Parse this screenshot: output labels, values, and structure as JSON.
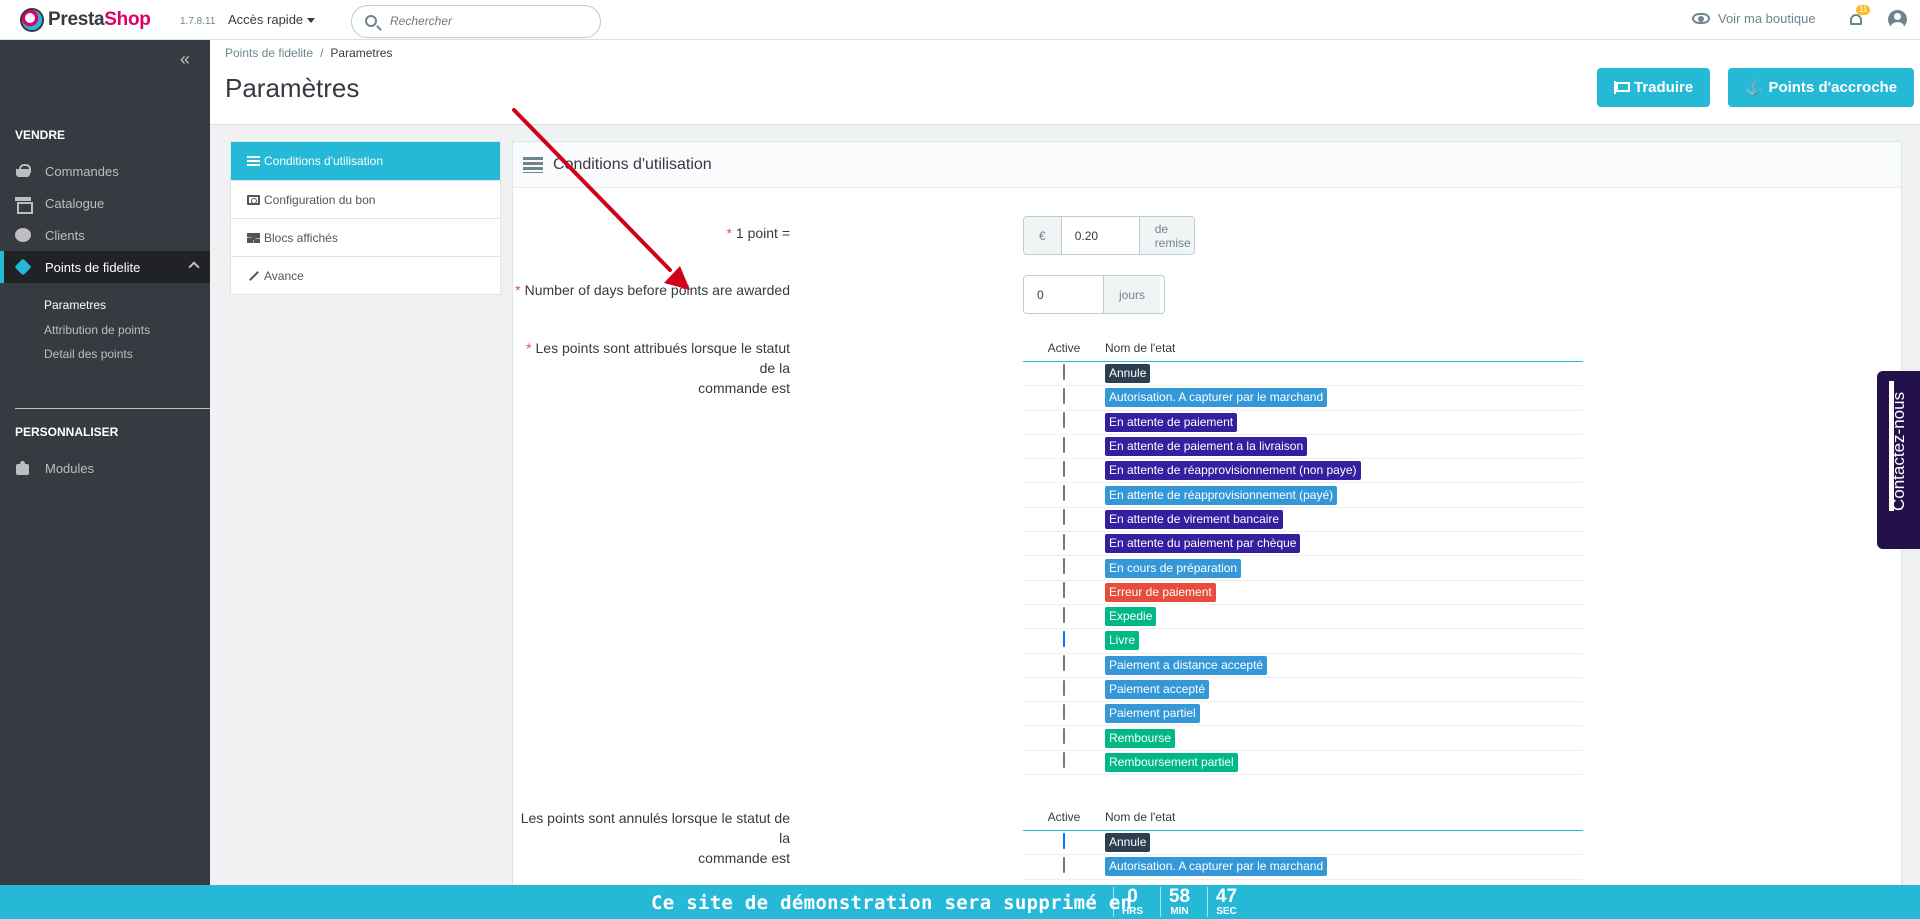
{
  "header": {
    "brand_part1": "Presta",
    "brand_part2": "Shop",
    "version": "1.7.8.11",
    "quick_access": "Accès rapide",
    "search_placeholder": "Rechercher",
    "view_shop": "Voir ma boutique",
    "notifications_count": "11"
  },
  "sidebar": {
    "collapse_icon": "double-chevron-left",
    "sections": [
      {
        "title": "VENDRE"
      },
      {
        "title": "PERSONNALISER"
      }
    ],
    "items": [
      {
        "label": "Commandes",
        "icon": "basket-icon"
      },
      {
        "label": "Catalogue",
        "icon": "store-icon"
      },
      {
        "label": "Clients",
        "icon": "user-circle-icon"
      },
      {
        "label": "Points de fidelite",
        "icon": "tag-icon",
        "active": true
      },
      {
        "label": "Modules",
        "icon": "puzzle-icon"
      }
    ],
    "subitems": [
      {
        "label": "Parametres",
        "current": true
      },
      {
        "label": "Attribution de points"
      },
      {
        "label": "Detail des points"
      }
    ]
  },
  "page": {
    "breadcrumb_parent": "Points de fidelite",
    "breadcrumb_sep": "/",
    "breadcrumb_current": "Parametres",
    "title": "Paramètres",
    "btn_translate": "Traduire",
    "btn_hooks": "Points d'accroche"
  },
  "tabs": [
    {
      "label": "Conditions d'utilisation",
      "active": true
    },
    {
      "label": "Configuration du bon"
    },
    {
      "label": "Blocs affichés"
    },
    {
      "label": "Avance"
    }
  ],
  "form": {
    "panel_title": "Conditions d'utilisation",
    "point_label": "1 point =",
    "point_currency": "€",
    "point_value": "0.20",
    "point_suffix": "de remise",
    "days_label": "Number of days before points are awarded",
    "days_value": "0",
    "days_suffix": "jours",
    "awarded_label_line1": "Les points sont attribués lorsque le statut de la",
    "awarded_label_line2": "commande est",
    "cancelled_label_line1": "Les points sont annulés lorsque le statut de la",
    "cancelled_label_line2": "commande est",
    "col_active": "Active",
    "col_state": "Nom de l'etat",
    "awarded_states": [
      {
        "name": "Annule",
        "color": "#2c3e50",
        "checked": false
      },
      {
        "name": "Autorisation. A capturer par le marchand",
        "color": "#3498d8",
        "checked": false
      },
      {
        "name": "En attente de paiement",
        "color": "#34209e",
        "checked": false
      },
      {
        "name": "En attente de paiement a la livraison",
        "color": "#34209e",
        "checked": false
      },
      {
        "name": "En attente de réapprovisionnement (non paye)",
        "color": "#34209e",
        "checked": false
      },
      {
        "name": "En attente de réapprovisionnement (payé)",
        "color": "#3498d8",
        "checked": false
      },
      {
        "name": "En attente de virement bancaire",
        "color": "#34209e",
        "checked": false
      },
      {
        "name": "En attente du paiement par chèque",
        "color": "#34209e",
        "checked": false
      },
      {
        "name": "En cours de préparation",
        "color": "#3498d8",
        "checked": false
      },
      {
        "name": "Erreur de paiement",
        "color": "#e74c3c",
        "checked": false
      },
      {
        "name": "Expedie",
        "color": "#01b887",
        "checked": false
      },
      {
        "name": "Livre",
        "color": "#01b887",
        "checked": true
      },
      {
        "name": "Paiement a distance accepté",
        "color": "#3498d8",
        "checked": false
      },
      {
        "name": "Paiement accepté",
        "color": "#3498d8",
        "checked": false
      },
      {
        "name": "Paiement partiel",
        "color": "#3498d8",
        "checked": false
      },
      {
        "name": "Rembourse",
        "color": "#01b887",
        "checked": false
      },
      {
        "name": "Remboursement partiel",
        "color": "#01b887",
        "checked": false
      }
    ],
    "cancelled_states": [
      {
        "name": "Annule",
        "color": "#2c3e50",
        "checked": true
      },
      {
        "name": "Autorisation. A capturer par le marchand",
        "color": "#3498d8",
        "checked": false
      }
    ]
  },
  "contact_tab": "Contactez-nous",
  "demo_bar": {
    "message": "Ce site de démonstration sera supprimé en",
    "hours": "0",
    "hours_unit": "HRS",
    "minutes": "58",
    "minutes_unit": "MIN",
    "seconds": "47",
    "seconds_unit": "SEC"
  },
  "colors": {
    "accent": "#25b9d7",
    "sidebar_bg": "#363a41",
    "annotation_arrow": "#d0021b"
  }
}
